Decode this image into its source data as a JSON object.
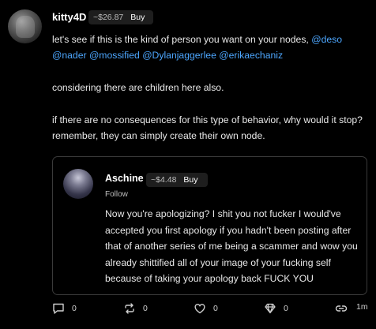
{
  "post": {
    "username": "kitty4D",
    "coin_price": "~$26.87",
    "buy_label": "Buy",
    "line1_prefix": "let's see if this is the kind of person you want on your nodes,",
    "mentions_line1": [
      "@deso"
    ],
    "mentions_line2": [
      "@nader",
      "@mossified",
      "@Dylanjaggerlee",
      "@erikaechaniz"
    ],
    "paragraph2": "considering there are children here also.",
    "paragraph3": "if there are no consequences for this type of behavior, why would it stop? remember, they can simply create their own node."
  },
  "quoted": {
    "username": "Aschine",
    "coin_price": "~$4.48",
    "buy_label": "Buy",
    "follow_label": "Follow",
    "text": "Now you're apologizing? I shit you not fucker I would've accepted you first apology if you hadn't been posting after that of another series of me being a scammer and wow you already shittified all of your image of your fucking self because of taking your apology back FUCK YOU"
  },
  "actions": {
    "comments": "0",
    "reposts": "0",
    "likes": "0",
    "diamonds": "0",
    "timestamp": "1m"
  },
  "colors": {
    "background": "#000000",
    "mention": "#4da7ff",
    "coin_bg": "#1e1e1e"
  }
}
